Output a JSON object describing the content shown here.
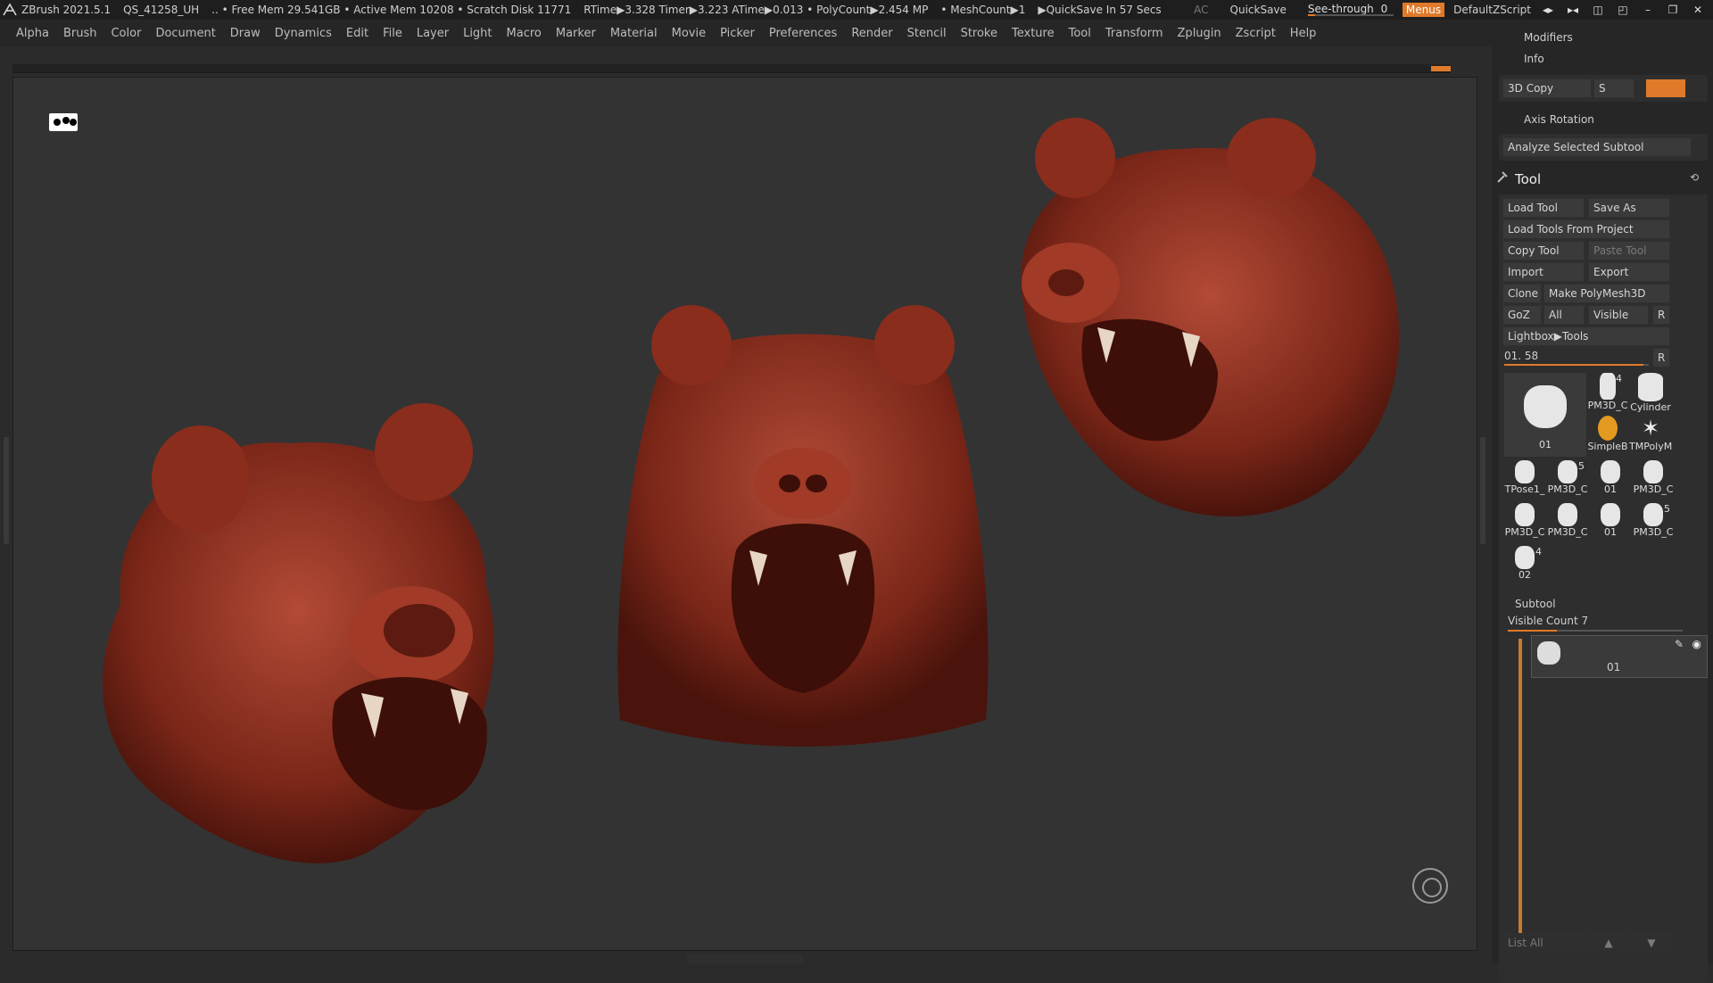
{
  "titlebar": {
    "app": "ZBrush 2021.5.1",
    "doc": "QS_41258_UH",
    "mem": ".. • Free Mem 29.541GB • Active Mem 10208 • Scratch Disk 11771",
    "rtime": "RTime▶3.328 Timer▶3.223 ATime▶0.013 • PolyCount▶2.454 MP",
    "meshcount": "• MeshCount▶1",
    "quicksave_in": "▶QuickSave In 57 Secs",
    "ac": "AC",
    "quicksave": "QuickSave",
    "see_through_label": "See-through",
    "see_through_value": "0",
    "see_through_level": 0.08,
    "menus": "Menus",
    "script": "DefaultZScript"
  },
  "menubar": {
    "items": [
      "Alpha",
      "Brush",
      "Color",
      "Document",
      "Draw",
      "Dynamics",
      "Edit",
      "File",
      "Layer",
      "Light",
      "Macro",
      "Marker",
      "Material",
      "Movie",
      "Picker",
      "Preferences",
      "Render",
      "Stencil",
      "Stroke",
      "Texture",
      "Tool",
      "Transform",
      "Zplugin",
      "Zscript",
      "Help"
    ]
  },
  "tray": {
    "modifiers": "Modifiers",
    "info": "Info",
    "copy3d": "3D Copy",
    "s_label": "S",
    "axis_rotation": "Axis Rotation",
    "analyze": "Analyze Selected Subtool",
    "tool_title": "Tool",
    "load_tool": "Load Tool",
    "save_as": "Save As",
    "load_from_project": "Load Tools From Project",
    "copy_tool": "Copy Tool",
    "paste_tool": "Paste Tool",
    "import": "Import",
    "export": "Export",
    "clone": "Clone",
    "make_polymesh": "Make PolyMesh3D",
    "goz": "GoZ",
    "all": "All",
    "visible": "Visible",
    "r": "R",
    "lightbox_tools": "Lightbox▶Tools",
    "tool_slider": "01. 58",
    "tool_slider_r": "R",
    "thumbs": [
      {
        "label": "01",
        "badge": ""
      },
      {
        "label": "PM3D_C",
        "badge": "4"
      },
      {
        "label": "Cylinder",
        "badge": ""
      },
      {
        "label": "SimpleB",
        "badge": ""
      },
      {
        "label": "TMPolyM",
        "badge": ""
      },
      {
        "label": "TPose1_",
        "badge": ""
      },
      {
        "label": "PM3D_C",
        "badge": "5"
      },
      {
        "label": "01",
        "badge": ""
      },
      {
        "label": "PM3D_C",
        "badge": ""
      },
      {
        "label": "PM3D_C",
        "badge": ""
      },
      {
        "label": "PM3D_C",
        "badge": ""
      },
      {
        "label": "01",
        "badge": ""
      },
      {
        "label": "PM3D_C",
        "badge": "5"
      },
      {
        "label": "02",
        "badge": "4"
      }
    ],
    "subtool": "Subtool",
    "visible_count": "Visible Count 7",
    "subtool_name": "01",
    "list_all": "List All"
  }
}
